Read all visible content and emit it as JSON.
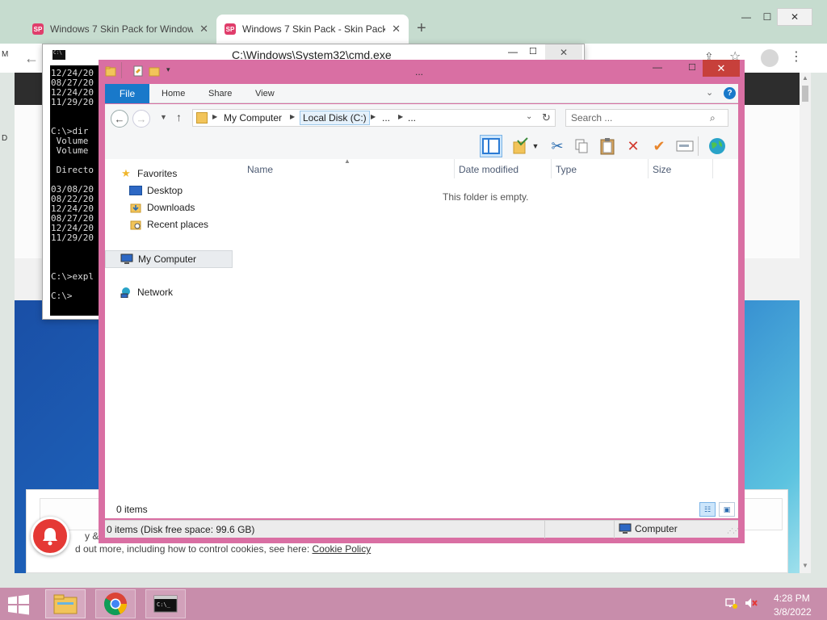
{
  "desktop": {
    "label_m": "M",
    "label_d": "D"
  },
  "chrome": {
    "tabs": [
      {
        "title": "Windows 7 Skin Pack for Windows",
        "favicon": "SP"
      },
      {
        "title": "Windows 7 Skin Pack - Skin Pack",
        "favicon": "SP"
      }
    ],
    "new_tab": "+",
    "cookie_line1": "y & Coo",
    "cookie_line2": "d out more, including how to control cookies, see here: ",
    "cookie_policy": "Cookie Policy",
    "accent": "#e03d6b",
    "notify_color": "#e53935"
  },
  "cmd": {
    "title": "C:\\Windows\\System32\\cmd.exe",
    "lines": [
      "12/24/20",
      "08/27/20",
      "12/24/20",
      "11/29/20",
      "",
      "",
      "C:\\>dir",
      " Volume",
      " Volume",
      "",
      " Directo",
      "",
      "03/08/20",
      "08/22/20",
      "12/24/20",
      "08/27/20",
      "12/24/20",
      "11/29/20",
      "",
      "",
      "",
      "C:\\>expl",
      "",
      "C:\\>"
    ]
  },
  "explorer": {
    "title": "...",
    "frame_color": "#d96fa3",
    "ribbon": {
      "file": "File",
      "home": "Home",
      "share": "Share",
      "view": "View"
    },
    "breadcrumbs": [
      "My Computer",
      "Local Disk (C:)",
      "...",
      "..."
    ],
    "search_placeholder": "Search ...",
    "nav": {
      "favorites": "Favorites",
      "desktop": "Desktop",
      "downloads": "Downloads",
      "recent": "Recent places",
      "my_computer": "My Computer",
      "network": "Network"
    },
    "columns": [
      "Name",
      "Date modified",
      "Type",
      "Size"
    ],
    "empty_message": "This folder is empty.",
    "status_count": "0 items",
    "details_text": "0 items (Disk free space: 99.6 GB)",
    "details_location": "Computer"
  },
  "taskbar": {
    "color": "#c88dab",
    "time": "4:28 PM",
    "date": "3/8/2022"
  }
}
